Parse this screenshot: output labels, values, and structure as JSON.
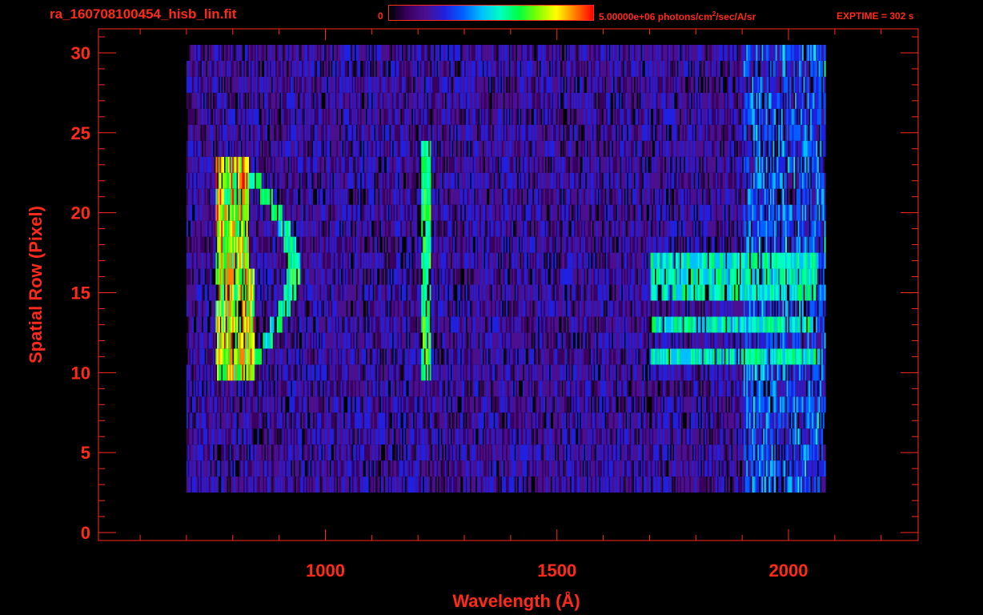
{
  "header": {
    "filename": "ra_160708100454_hisb_lin.fit",
    "colorbar_min_label": "0",
    "colorbar_max_label": "5.00000e+06 photons/cm",
    "colorbar_max_exp": "2",
    "colorbar_max_units_suffix": "/sec/A/sr",
    "exptime_label": "EXPTIME = 302 s"
  },
  "colors": {
    "axis": "#ff2a1a",
    "background": "#000000",
    "colormap": [
      "#000000",
      "#3a0060",
      "#4a1090",
      "#2020e0",
      "#0060ff",
      "#00c0ff",
      "#00ffc0",
      "#00ff40",
      "#80ff00",
      "#ffff00",
      "#ff8000",
      "#ff0000"
    ]
  },
  "chart_data": {
    "type": "heatmap",
    "title": "",
    "xlabel": "Wavelength (Å)",
    "ylabel": "Spatial Row (Pixel)",
    "xlim": [
      510,
      2280
    ],
    "ylim": [
      -0.5,
      31.5
    ],
    "x_ticks": [
      1000,
      1500,
      2000
    ],
    "x_tick_labels": [
      "1000",
      "1500",
      "2000"
    ],
    "y_ticks": [
      0,
      5,
      10,
      15,
      20,
      25,
      30
    ],
    "y_tick_labels": [
      "0",
      "5",
      "10",
      "15",
      "20",
      "25",
      "30"
    ],
    "value_range": [
      0,
      5000000
    ],
    "value_units": "photons/cm^2/sec/A/sr",
    "data_extent_wavelength": [
      700,
      2080
    ],
    "data_extent_rows": [
      3,
      30
    ],
    "features": [
      {
        "name": "arc",
        "center_wavelength": 840,
        "row_range": [
          10,
          23
        ]
      },
      {
        "name": "line",
        "center_wavelength": 1216,
        "row_range": [
          10,
          24
        ]
      },
      {
        "name": "band",
        "wavelength_range": [
          1700,
          2060
        ],
        "row_range": [
          11,
          17
        ]
      }
    ]
  }
}
